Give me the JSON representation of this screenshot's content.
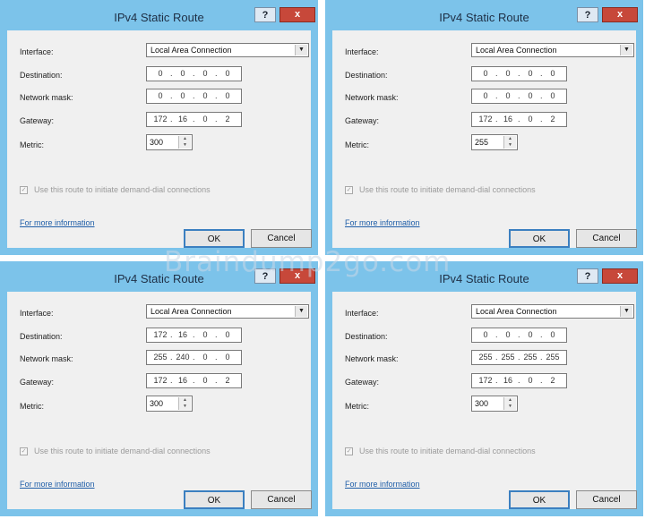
{
  "dialogs": [
    {
      "title": "IPv4 Static Route",
      "help_label": "?",
      "close_label": "x",
      "labels": {
        "interface": "Interface:",
        "destination": "Destination:",
        "netmask": "Network mask:",
        "gateway": "Gateway:",
        "metric": "Metric:"
      },
      "interface": "Local Area Connection",
      "destination": [
        "0",
        "0",
        "0",
        "0"
      ],
      "netmask": [
        "0",
        "0",
        "0",
        "0"
      ],
      "gateway": [
        "172",
        "16",
        "0",
        "2"
      ],
      "metric": "300",
      "checkbox_label": "Use this route to initiate demand-dial connections",
      "checkbox_checked": true,
      "more_info": "For more information",
      "ok": "OK",
      "cancel": "Cancel"
    },
    {
      "title": "IPv4 Static Route",
      "help_label": "?",
      "close_label": "x",
      "labels": {
        "interface": "Interface:",
        "destination": "Destination:",
        "netmask": "Network mask:",
        "gateway": "Gateway:",
        "metric": "Metric:"
      },
      "interface": "Local Area Connection",
      "destination": [
        "0",
        "0",
        "0",
        "0"
      ],
      "netmask": [
        "0",
        "0",
        "0",
        "0"
      ],
      "gateway": [
        "172",
        "16",
        "0",
        "2"
      ],
      "metric": "255",
      "checkbox_label": "Use this route to initiate demand-dial connections",
      "checkbox_checked": true,
      "more_info": "For more information",
      "ok": "OK",
      "cancel": "Cancel"
    },
    {
      "title": "IPv4 Static Route",
      "help_label": "?",
      "close_label": "x",
      "labels": {
        "interface": "Interface:",
        "destination": "Destination:",
        "netmask": "Network mask:",
        "gateway": "Gateway:",
        "metric": "Metric:"
      },
      "interface": "Local Area Connection",
      "destination": [
        "172",
        "16",
        "0",
        "0"
      ],
      "netmask": [
        "255",
        "240",
        "0",
        "0"
      ],
      "gateway": [
        "172",
        "16",
        "0",
        "2"
      ],
      "metric": "300",
      "checkbox_label": "Use this route to initiate demand-dial connections",
      "checkbox_checked": true,
      "more_info": "For more information",
      "ok": "OK",
      "cancel": "Cancel"
    },
    {
      "title": "IPv4 Static Route",
      "help_label": "?",
      "close_label": "x",
      "labels": {
        "interface": "Interface:",
        "destination": "Destination:",
        "netmask": "Network mask:",
        "gateway": "Gateway:",
        "metric": "Metric:"
      },
      "interface": "Local Area Connection",
      "destination": [
        "0",
        "0",
        "0",
        "0"
      ],
      "netmask": [
        "255",
        "255",
        "255",
        "255"
      ],
      "gateway": [
        "172",
        "16",
        "0",
        "2"
      ],
      "metric": "300",
      "checkbox_label": "Use this route to initiate demand-dial connections",
      "checkbox_checked": true,
      "more_info": "For more information",
      "ok": "OK",
      "cancel": "Cancel"
    }
  ],
  "icons": {
    "dropdown": "chevron-down-icon",
    "spinner": "spin-arrows-icon",
    "help": "question-icon",
    "close": "close-icon"
  },
  "colors": {
    "titlebar": "#7cc3ea",
    "close": "#c7483a",
    "link": "#1f5ea8",
    "ok_border": "#3b7fc0"
  },
  "watermark": "Braindump2go.com"
}
